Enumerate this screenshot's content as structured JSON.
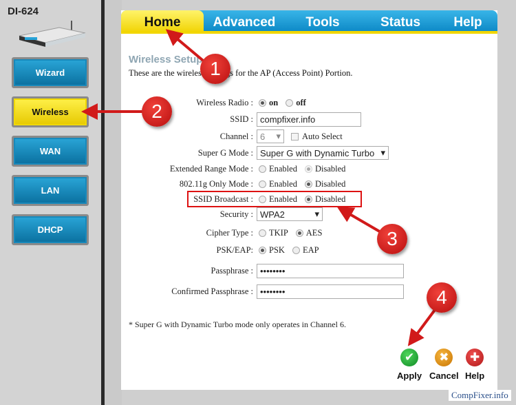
{
  "device": {
    "model": "DI-624"
  },
  "sidebar": {
    "items": [
      {
        "label": "Wizard"
      },
      {
        "label": "Wireless",
        "active": true
      },
      {
        "label": "WAN"
      },
      {
        "label": "LAN"
      },
      {
        "label": "DHCP"
      }
    ]
  },
  "tabs": [
    {
      "label": "Home",
      "active": true
    },
    {
      "label": "Advanced"
    },
    {
      "label": "Tools"
    },
    {
      "label": "Status"
    },
    {
      "label": "Help"
    }
  ],
  "page": {
    "title": "Wireless Setup",
    "intro": "These are the wireless settings for the AP (Access Point) Portion."
  },
  "form": {
    "wireless_radio": {
      "label": "Wireless Radio :",
      "on": "on",
      "off": "off",
      "value": "on"
    },
    "ssid": {
      "label": "SSID :",
      "value": "compfixer.info"
    },
    "channel": {
      "label": "Channel :",
      "value": "6",
      "auto_select": "Auto Select",
      "auto_checked": false
    },
    "super_g": {
      "label": "Super G Mode :",
      "value": "Super G with Dynamic Turbo"
    },
    "extended_range": {
      "label": "Extended Range Mode :",
      "enabled": "Enabled",
      "disabled": "Disabled",
      "value": "Disabled"
    },
    "g_only": {
      "label": "802.11g Only Mode :",
      "enabled": "Enabled",
      "disabled": "Disabled",
      "value": "Disabled"
    },
    "ssid_broadcast": {
      "label": "SSID Broadcast :",
      "enabled": "Enabled",
      "disabled": "Disabled",
      "value": "Disabled"
    },
    "security": {
      "label": "Security :",
      "value": "WPA2"
    },
    "cipher": {
      "label": "Cipher Type :",
      "tkip": "TKIP",
      "aes": "AES",
      "value": "AES"
    },
    "psk_eap": {
      "label": "PSK/EAP:",
      "psk": "PSK",
      "eap": "EAP",
      "value": "PSK"
    },
    "passphrase": {
      "label": "Passphrase :",
      "value": "••••••••"
    },
    "confirm": {
      "label": "Confirmed Passphrase :",
      "value": "••••••••"
    }
  },
  "note": "* Super G with Dynamic Turbo mode only operates in Channel 6.",
  "actions": {
    "apply": "Apply",
    "cancel": "Cancel",
    "help": "Help"
  },
  "annotations": [
    "1",
    "2",
    "3",
    "4"
  ],
  "watermark": "CompFixer.info",
  "colors": {
    "tab_blue": "#0a86c4",
    "tab_yellow": "#f0d200",
    "annotation_red": "#d11a1a"
  }
}
